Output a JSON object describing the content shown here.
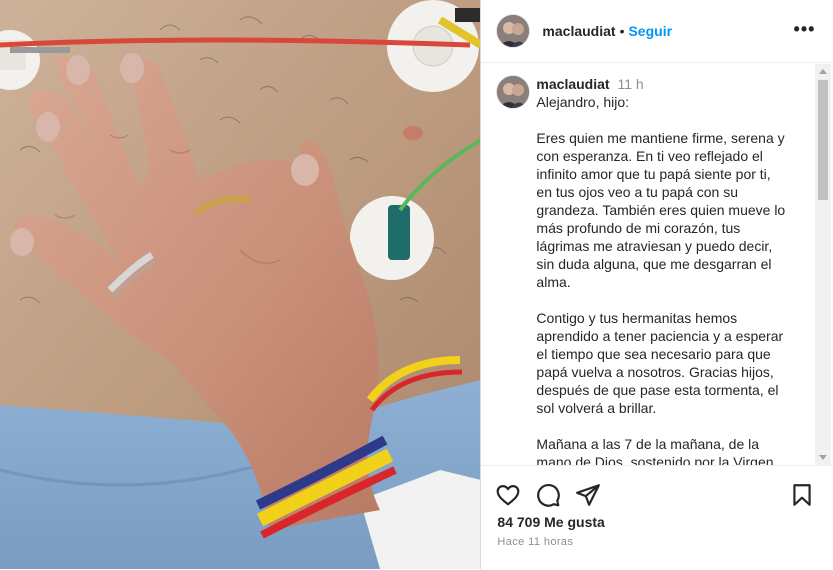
{
  "post": {
    "author": {
      "username": "maclaudiat",
      "follow_label": "Seguir",
      "separator": "•"
    },
    "caption": {
      "username": "maclaudiat",
      "time": "11 h",
      "paragraphs": [
        "Alejandro, hijo:",
        "Eres quien me mantiene firme, serena y con esperanza. En ti veo reflejado el infinito amor que tu papá siente por ti, en tus ojos veo a tu papá con su grandeza. También eres quien mueve lo más profundo de mi corazón, tus lágrimas me atraviesan y puedo decir, sin duda alguna, que me desgarran el alma.",
        "Contigo y tus hermanitas hemos aprendido a tener paciencia y a esperar el tiempo que sea necesario para que papá vuelva a nosotros. Gracias hijos, después de que pase esta tormenta, el sol volverá a brillar.",
        "Mañana a las 7 de la mañana, de la mano de Dios, sostenido por la Virgen"
      ]
    },
    "likes": "84 709 Me gusta",
    "timestamp": "Hace 11 horas",
    "icons": {
      "like": "heart-icon",
      "comment": "comment-icon",
      "share": "share-icon",
      "save": "bookmark-icon",
      "more": "more-options-icon"
    },
    "colors": {
      "link": "#0095f6",
      "text": "#262626",
      "muted": "#8e8e8e",
      "border": "#dbdbdb"
    }
  }
}
